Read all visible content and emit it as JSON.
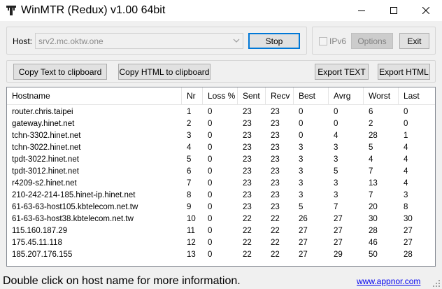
{
  "window": {
    "title": "WinMTR (Redux) v1.00 64bit",
    "icon": "winmtr-app-icon",
    "controls": [
      "minimize-icon",
      "maximize-icon",
      "close-icon"
    ]
  },
  "host": {
    "label": "Host:",
    "value": "srv2.mc.oktw.one",
    "stop_label": "Stop"
  },
  "options": {
    "ipv6_label": "IPv6",
    "ipv6_checked": false,
    "options_label": "Options",
    "exit_label": "Exit"
  },
  "toolbar": {
    "copy_text": "Copy Text to clipboard",
    "copy_html": "Copy HTML to clipboard",
    "export_text": "Export TEXT",
    "export_html": "Export HTML"
  },
  "table": {
    "columns": [
      "Hostname",
      "Nr",
      "Loss %",
      "Sent",
      "Recv",
      "Best",
      "Avrg",
      "Worst",
      "Last"
    ],
    "rows": [
      [
        "router.chris.taipei",
        "1",
        "0",
        "23",
        "23",
        "0",
        "0",
        "6",
        "0"
      ],
      [
        "gateway.hinet.net",
        "2",
        "0",
        "23",
        "23",
        "0",
        "0",
        "2",
        "0"
      ],
      [
        "tchn-3302.hinet.net",
        "3",
        "0",
        "23",
        "23",
        "0",
        "4",
        "28",
        "1"
      ],
      [
        "tchn-3022.hinet.net",
        "4",
        "0",
        "23",
        "23",
        "3",
        "3",
        "5",
        "4"
      ],
      [
        "tpdt-3022.hinet.net",
        "5",
        "0",
        "23",
        "23",
        "3",
        "3",
        "4",
        "4"
      ],
      [
        "tpdt-3012.hinet.net",
        "6",
        "0",
        "23",
        "23",
        "3",
        "5",
        "7",
        "4"
      ],
      [
        "r4209-s2.hinet.net",
        "7",
        "0",
        "23",
        "23",
        "3",
        "3",
        "13",
        "4"
      ],
      [
        "210-242-214-185.hinet-ip.hinet.net",
        "8",
        "0",
        "23",
        "23",
        "3",
        "3",
        "7",
        "3"
      ],
      [
        "61-63-63-host105.kbtelecom.net.tw",
        "9",
        "0",
        "23",
        "23",
        "5",
        "7",
        "20",
        "8"
      ],
      [
        "61-63-63-host38.kbtelecom.net.tw",
        "10",
        "0",
        "22",
        "22",
        "26",
        "27",
        "30",
        "30"
      ],
      [
        "115.160.187.29",
        "11",
        "0",
        "22",
        "22",
        "27",
        "27",
        "28",
        "27"
      ],
      [
        "175.45.11.118",
        "12",
        "0",
        "22",
        "22",
        "27",
        "27",
        "46",
        "27"
      ],
      [
        "185.207.176.155",
        "13",
        "0",
        "22",
        "22",
        "27",
        "29",
        "50",
        "28"
      ]
    ]
  },
  "status": {
    "message": "Double click on host name for more information.",
    "link": "www.appnor.com"
  }
}
